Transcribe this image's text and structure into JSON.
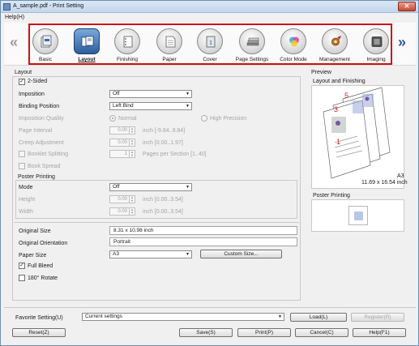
{
  "window": {
    "title": "A_sample.pdf - Print Setting",
    "close_glyph": "✕"
  },
  "menu": {
    "help": "Help(H)"
  },
  "nav": {
    "prev_glyph": "«",
    "next_glyph": "»",
    "items": [
      {
        "label": "Basic",
        "icon": "basic-icon"
      },
      {
        "label": "Layout",
        "icon": "layout-icon",
        "selected": true
      },
      {
        "label": "Finishing",
        "icon": "finishing-icon"
      },
      {
        "label": "Paper",
        "icon": "paper-icon"
      },
      {
        "label": "Cover",
        "icon": "cover-icon"
      },
      {
        "label": "Page Settings",
        "icon": "page-settings-icon"
      },
      {
        "label": "Color Mode",
        "icon": "color-mode-icon"
      },
      {
        "label": "Management",
        "icon": "management-icon"
      },
      {
        "label": "Imaging",
        "icon": "imaging-icon"
      }
    ]
  },
  "layout": {
    "group_label": "Layout",
    "two_sided": {
      "label": "2-Sided",
      "checked": true
    },
    "imposition": {
      "label": "Imposition",
      "value": "Off"
    },
    "binding_position": {
      "label": "Binding Position",
      "value": "Left Bind"
    },
    "imposition_quality": {
      "label": "Imposition Quality",
      "options": [
        "Normal",
        "High Precision"
      ],
      "selected": "Normal"
    },
    "page_interval": {
      "label": "Page Interval",
      "value": "0.00",
      "unit": "inch [-9.84..9.84]"
    },
    "creep_adjustment": {
      "label": "Creep Adjustment",
      "value": "0.00",
      "unit": "inch [0.00..1.97]"
    },
    "booklet_splitting": {
      "label": "Booklet Splitting",
      "value": "1",
      "unit": "Pages per Section [1..40]",
      "checked": false
    },
    "book_spread": {
      "label": "Book Spread",
      "checked": false
    }
  },
  "poster": {
    "group_label": "Poster Printing",
    "mode": {
      "label": "Mode",
      "value": "Off"
    },
    "height": {
      "label": "Height",
      "value": "0.00",
      "unit": "inch [0.00..3.54]"
    },
    "width": {
      "label": "Width",
      "value": "0.00",
      "unit": "inch [0.00..3.54]"
    }
  },
  "original": {
    "size": {
      "label": "Original Size",
      "value": "8.31 x 10.98 inch"
    },
    "orientation": {
      "label": "Original Orientation",
      "value": "Portrait"
    },
    "paper_size": {
      "label": "Paper Size",
      "value": "A3"
    },
    "custom_size_button": "Custom Size...",
    "full_bleed": {
      "label": "Full Bleed",
      "checked": true
    },
    "rotate_180": {
      "label": "180°  Rotate",
      "checked": false
    }
  },
  "preview": {
    "group_label": "Preview",
    "layout_finishing_label": "Layout and Finishing",
    "page_numbers": [
      "5",
      "3",
      "1"
    ],
    "paper_name": "A3",
    "paper_dimensions": "11.69 x 16.54 inch",
    "poster_printing_label": "Poster Printing"
  },
  "favorite": {
    "label": "Favorite Setting(U)",
    "value": "Current settings",
    "load_button": "Load(L)",
    "register_button": "Register(R)"
  },
  "footer": {
    "reset": "Reset(Z)",
    "save": "Save(S)",
    "print": "Print(P)",
    "cancel": "Cancel(C)",
    "help": "Help(F1)"
  },
  "colors": {
    "accent": "#2c5aa0",
    "highlight_border": "#cc1111",
    "page_number_red": "#cc2222"
  }
}
